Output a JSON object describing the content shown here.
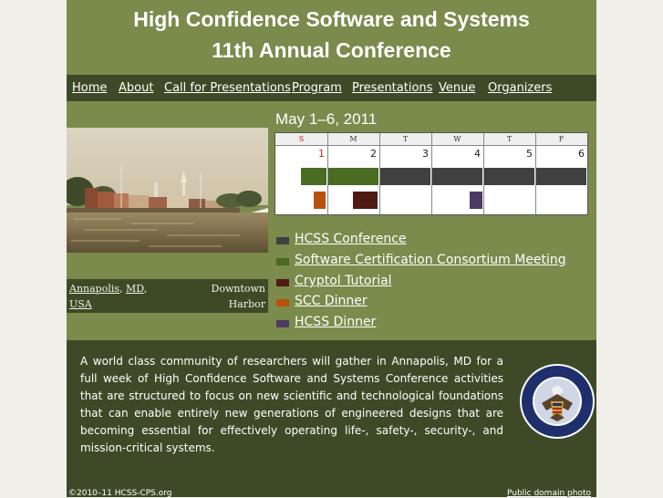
{
  "header": {
    "title_line1": "High Confidence Software and Systems",
    "title_line2": "11th Annual Conference"
  },
  "nav": {
    "items": [
      {
        "label": "Home"
      },
      {
        "label": "About"
      },
      {
        "label": "Call for Presentations"
      },
      {
        "label": "Program"
      },
      {
        "label": "Presentations"
      },
      {
        "label": "Venue"
      },
      {
        "label": "Organizers"
      }
    ]
  },
  "photo": {
    "caption_place_1": "Annapolis",
    "caption_place_2": "MD",
    "caption_place_3": "USA",
    "caption_right_1": "Downtown",
    "caption_right_2": "Harbor"
  },
  "calendar": {
    "date_range": "May 1–6, 2011",
    "day_headers": [
      "S",
      "M",
      "T",
      "W",
      "T",
      "F"
    ],
    "dates": [
      "1",
      "2",
      "3",
      "4",
      "5",
      "6"
    ],
    "sunday_color": "#cc2200"
  },
  "legend": {
    "items": [
      {
        "label": "HCSS Conference",
        "color": "#404040"
      },
      {
        "label": "Software Certification Consortium Meeting",
        "color": "#4a6b22"
      },
      {
        "label": "Cryptol Tutorial",
        "color": "#4f1a14"
      },
      {
        "label": "SCC Dinner",
        "color": "#b8500e"
      },
      {
        "label": "HCSS Dinner",
        "color": "#4d3a63"
      }
    ]
  },
  "description": "A world class community of researchers will gather in Annapolis, MD for a full week of High Confidence Software and Systems Conference activities that are structured to focus on new scientific and technological foundations that can enable entirely new generations of engineered designs that are becoming essential for effectively operating life-, safety-, security-, and mission-critical systems.",
  "seal": {
    "top_text": "NATIONAL SECURITY AGENCY",
    "bottom_text": "UNITED STATES OF AMERICA"
  },
  "footer": {
    "copyright": "©2010–11 HCSS-CPS.org",
    "photo_credit": "Public domain photo"
  },
  "colors": {
    "page_bg": "#7a8b4c",
    "nav_bg": "#3e4a27",
    "outer_bg": "#f0efe9"
  }
}
